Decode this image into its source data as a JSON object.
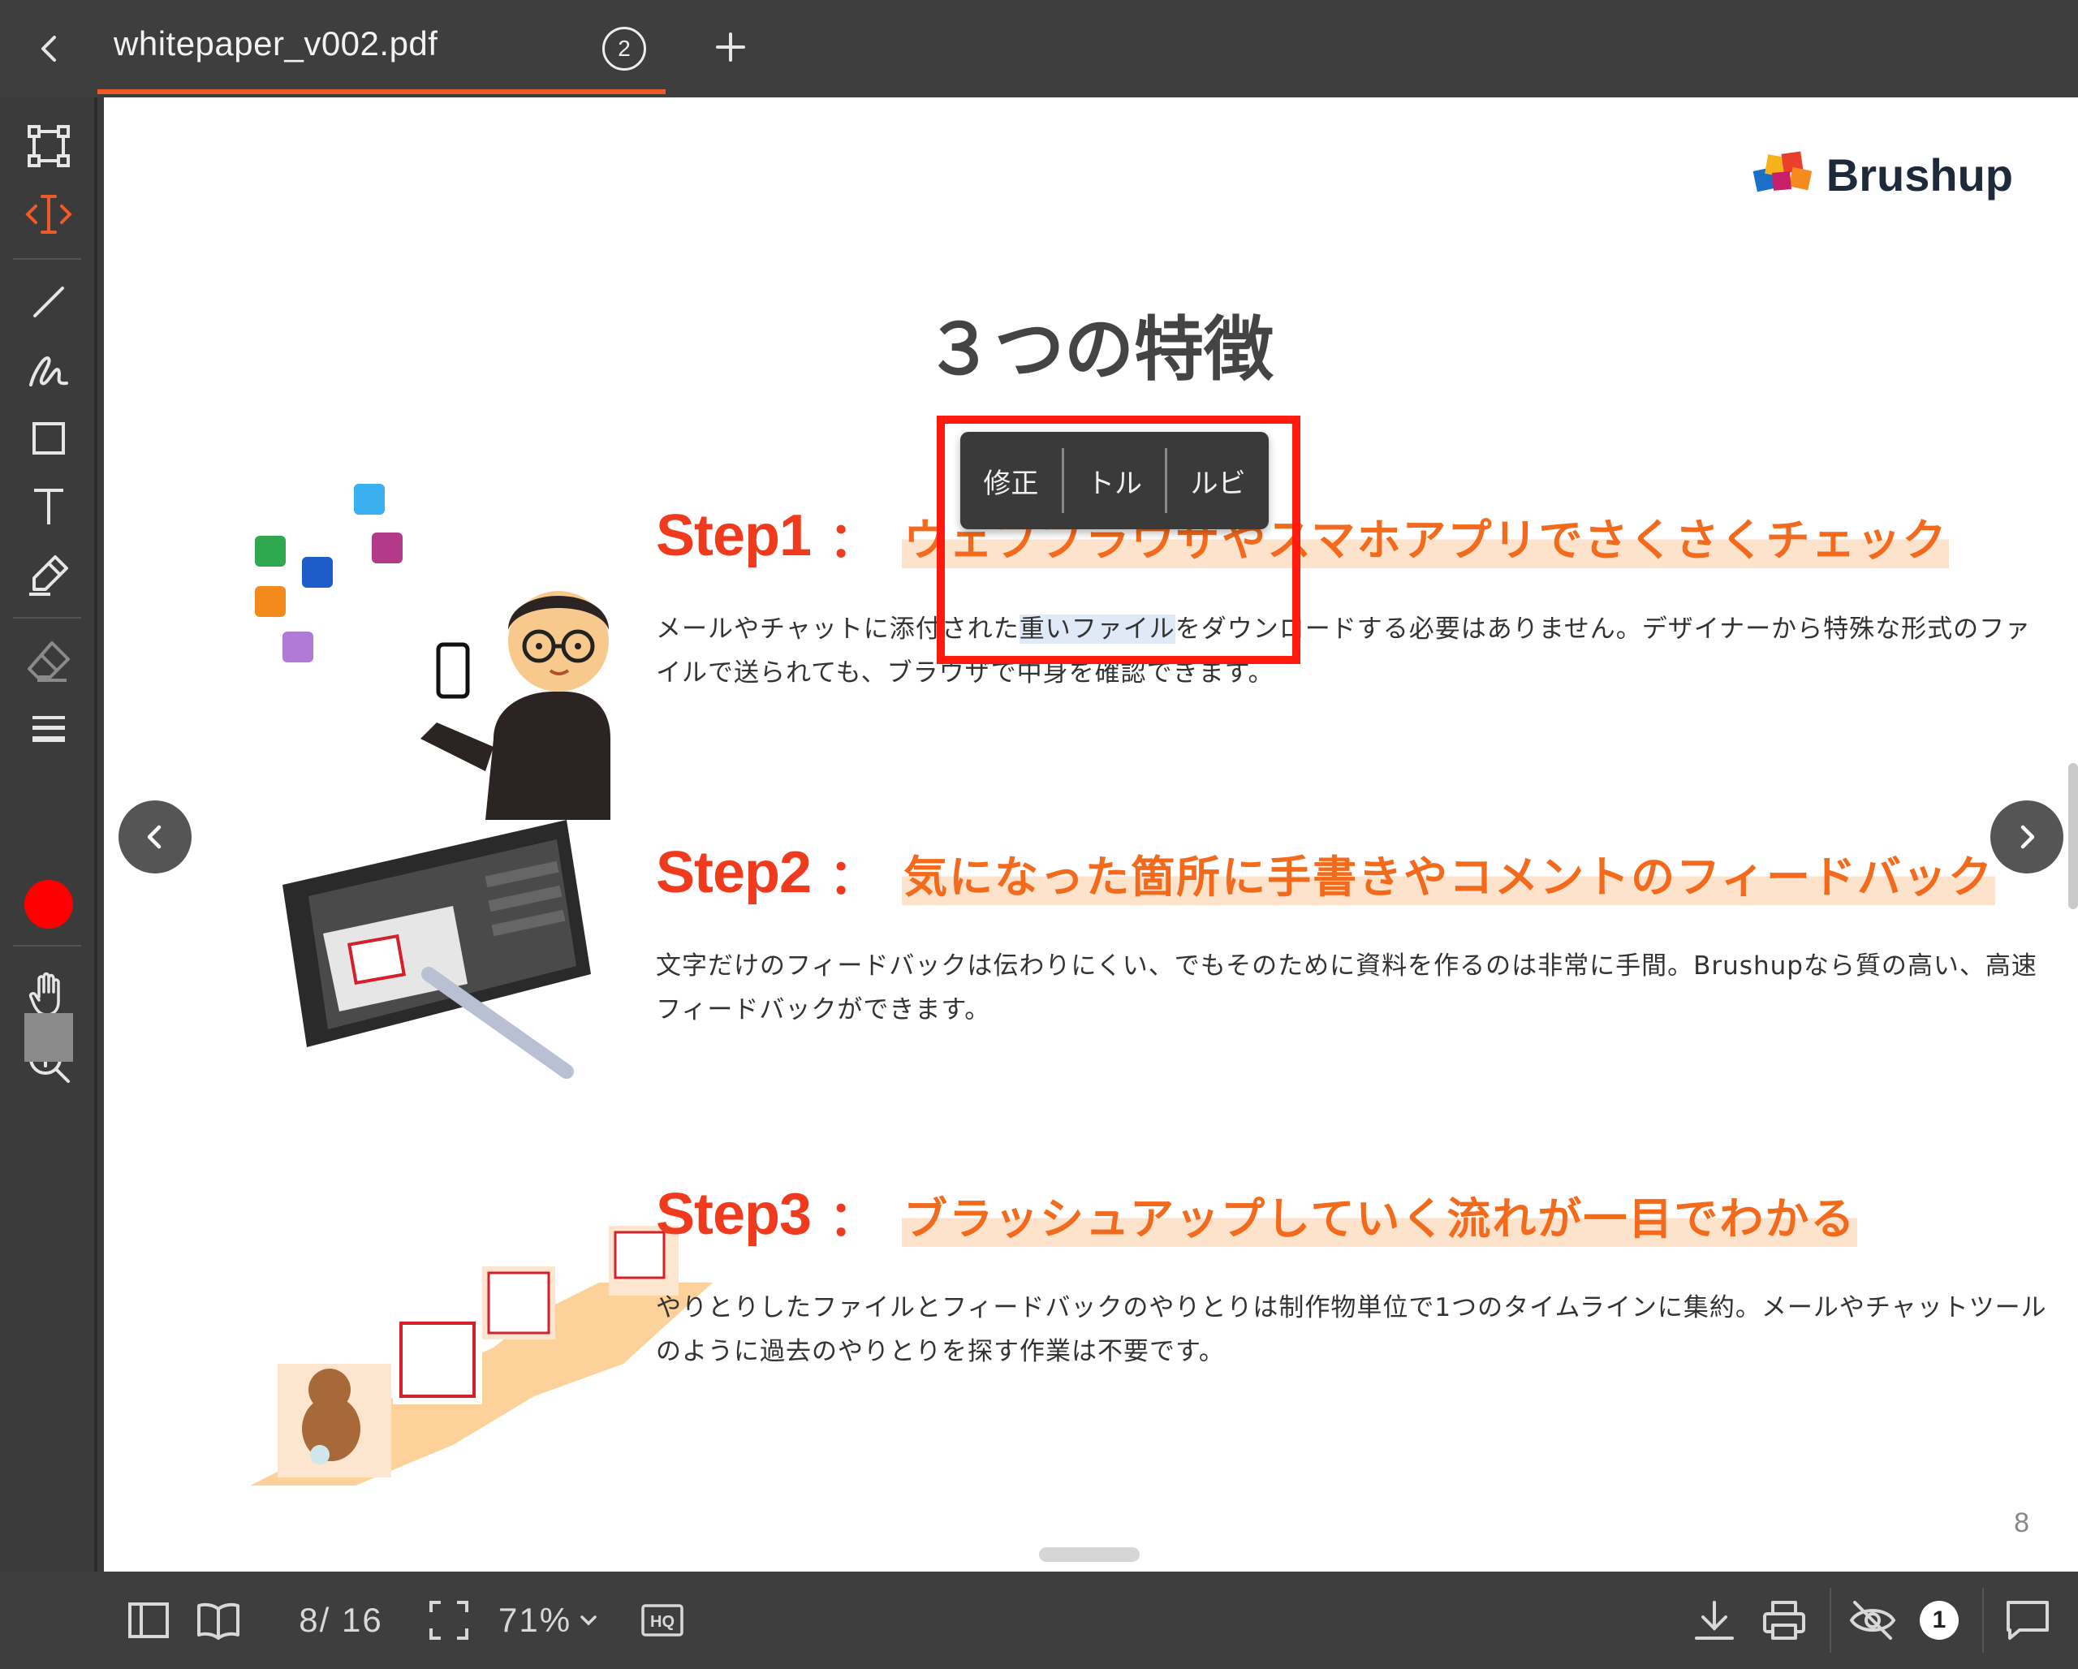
{
  "tab": {
    "title": "whitepaper_v002.pdf",
    "badge": "2"
  },
  "document": {
    "brand": "Brushup",
    "title": "３つの特徴",
    "page_number": "8",
    "steps": [
      {
        "label": "Step1",
        "colon": "：",
        "title": "ウェブブラウザやスマホアプリでさくさくチェック",
        "body_pre": "メールやチャットに添付された",
        "body_selected": "重いファイル",
        "body_post": "をダウンロードする必要はありません。デザイナーから特殊な形式のファイルで送られても、ブラウザで中身を確認できます。"
      },
      {
        "label": "Step2",
        "colon": "：",
        "title": "気になった箇所に手書きやコメントのフィードバック",
        "body": "文字だけのフィードバックは伝わりにくい、でもそのために資料を作るのは非常に手間。Brushupなら質の高い、高速フィードバックができます。"
      },
      {
        "label": "Step3",
        "colon": "：",
        "title": "ブラッシュアップしていく流れが一目でわかる",
        "body": "やりとりしたファイルとフィードバックのやりとりは制作物単位で1つのタイムラインに集約。メールやチャットツールのように過去のやりとりを探す作業は不要です。"
      }
    ]
  },
  "selection_popup": {
    "items": [
      "修正",
      "トル",
      "ルビ"
    ]
  },
  "bottombar": {
    "page_indicator": "8/ 16",
    "zoom": "71%",
    "hq_label": "HQ",
    "hidden_count": "1"
  },
  "colors": {
    "accent": "#f05a28",
    "step_red": "#f03a1e",
    "step_orange": "#f46a1c",
    "annotation_color": "#ff0000"
  },
  "icons": {
    "left_tools": [
      "select-rect-icon",
      "text-select-icon",
      "line-icon",
      "freehand-icon",
      "rectangle-icon",
      "text-icon",
      "highlighter-icon",
      "eraser-icon",
      "line-weight-icon",
      "color-swatch",
      "hand-icon",
      "zoom-in-icon",
      "fill-swatch"
    ],
    "bottom": [
      "sidebar-icon",
      "book-icon",
      "fit-screen-icon",
      "chevron-down-icon",
      "hq-icon",
      "download-icon",
      "print-icon",
      "eye-off-icon",
      "comment-icon"
    ]
  }
}
